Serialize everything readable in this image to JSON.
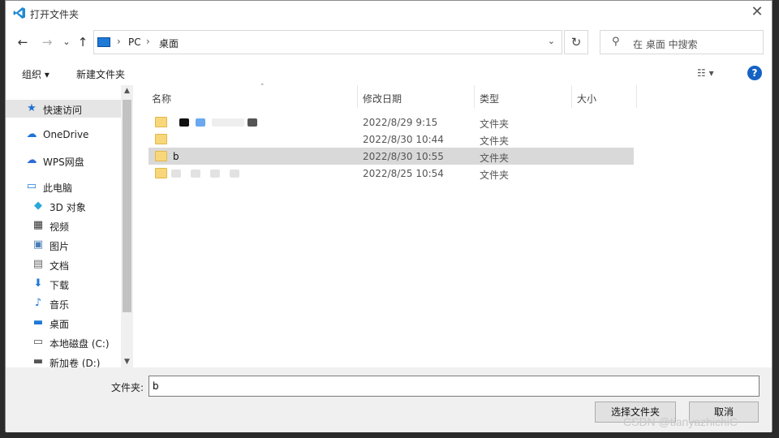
{
  "window": {
    "title": "打开文件夹"
  },
  "nav": {
    "back": "←",
    "forward": "→",
    "recent": "⌄",
    "up": "↑"
  },
  "address": {
    "crumbs": [
      "PC",
      "桌面"
    ],
    "separator": "›",
    "dropdown": "⌄"
  },
  "refresh": "↻",
  "search": {
    "placeholder": "在 桌面 中搜索"
  },
  "toolbar": {
    "organize": "组织 ▾",
    "new_folder": "新建文件夹",
    "view": "☷ ▾",
    "help": "?"
  },
  "sidebar": {
    "items": [
      {
        "label": "快速访问",
        "icon": "star-icon",
        "glyph": "★",
        "color": "#1d6fd1"
      },
      {
        "label": "OneDrive",
        "icon": "cloud-icon",
        "glyph": "☁",
        "color": "#1d73d8"
      },
      {
        "label": "WPS网盘",
        "icon": "cloud-icon",
        "glyph": "☁",
        "color": "#2e6bd8"
      },
      {
        "label": "此电脑",
        "icon": "computer-icon",
        "glyph": "▭",
        "color": "#1e7ad6"
      },
      {
        "label": "3D 对象",
        "icon": "cube-icon",
        "glyph": "◆",
        "color": "#29a8d9"
      },
      {
        "label": "视频",
        "icon": "film-icon",
        "glyph": "▦",
        "color": "#333333"
      },
      {
        "label": "图片",
        "icon": "picture-icon",
        "glyph": "▣",
        "color": "#4a7fb5"
      },
      {
        "label": "文档",
        "icon": "document-icon",
        "glyph": "▤",
        "color": "#6a6a6a"
      },
      {
        "label": "下载",
        "icon": "download-icon",
        "glyph": "⬇",
        "color": "#1e78d4"
      },
      {
        "label": "音乐",
        "icon": "music-icon",
        "glyph": "♪",
        "color": "#1e78d4"
      },
      {
        "label": "桌面",
        "icon": "desktop-icon",
        "glyph": "▬",
        "color": "#1e7ad6"
      },
      {
        "label": "本地磁盘 (C:)",
        "icon": "drive-icon",
        "glyph": "▭",
        "color": "#555555"
      },
      {
        "label": "新加卷 (D:)",
        "icon": "drive-icon",
        "glyph": "▬",
        "color": "#555555"
      }
    ],
    "scroll_up": "▲",
    "scroll_down": "▼"
  },
  "columns": {
    "name": "名称",
    "date": "修改日期",
    "type": "类型",
    "size": "大小",
    "sort": "˄"
  },
  "files": [
    {
      "name": "",
      "date": "2022/8/29 9:15",
      "type": "文件夹"
    },
    {
      "name": "",
      "date": "2022/8/30 10:44",
      "type": "文件夹"
    },
    {
      "name": "b",
      "date": "2022/8/30 10:55",
      "type": "文件夹"
    },
    {
      "name": "",
      "date": "2022/8/25 10:54",
      "type": "文件夹"
    }
  ],
  "footer": {
    "folder_label": "文件夹:",
    "folder_value": "b",
    "select_button": "选择文件夹",
    "cancel_button": "取消"
  },
  "watermark": "CSDN @tianyazhichiC",
  "colors": {
    "accent": "#1462c4",
    "selected_row": "#d9d9d9",
    "folder": "#f7d77a"
  }
}
